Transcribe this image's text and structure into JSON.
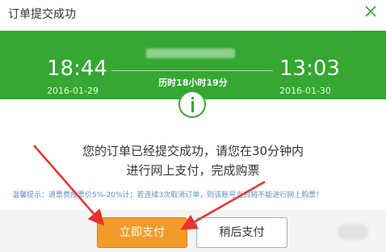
{
  "dialog": {
    "title": "订单提交成功",
    "close_icon": "close-icon"
  },
  "trip": {
    "depart_time": "18:44",
    "depart_date": "2016-01-29",
    "arrive_time": "13:03",
    "arrive_date": "2016-01-30",
    "duration": "历时18小时19分"
  },
  "message": {
    "line1": "您的订单已经提交成功，请您在30分钟内",
    "line2": "进行网上支付，完成购票",
    "tip": "温馨提示：退票费按票价5%-20%计；若连续3次取消订单，则该账号当日将不能进行网上购票！"
  },
  "buttons": {
    "pay_now": "立即支付",
    "pay_later": "稍后支付"
  },
  "colors": {
    "banner": "#35a732",
    "pay_button": "#f39b2a",
    "annotation_arrow": "#e8322d"
  }
}
